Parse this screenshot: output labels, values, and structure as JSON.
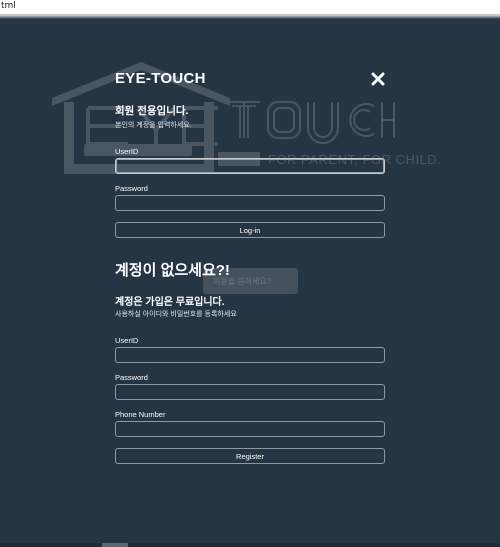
{
  "browser": {
    "url_fragment": "tml"
  },
  "background": {
    "logo_text": "TOUCH",
    "tagline": "FOR PARENT, FOR CHILD.",
    "hint": "이용을 원하세요?"
  },
  "login": {
    "brand": "EYE-TOUCH",
    "title": "회원 전용입니다.",
    "subtitle": "본인의 계정을 입력하세요.",
    "userid_label": "UserID",
    "userid_value": "",
    "password_label": "Password",
    "password_value": "",
    "button_label": "Log-in"
  },
  "register": {
    "heading": "계정이 없으세요?!",
    "title": "계정은 가입은 무료입니다.",
    "subtitle": "사용하실 아이디와 비밀번호를 등록하세요",
    "userid_label": "UserID",
    "userid_value": "",
    "password_label": "Password",
    "password_value": "",
    "phone_label": "Phone Number",
    "phone_value": "",
    "button_label": "Register"
  },
  "icons": {
    "close": "close-icon"
  },
  "colors": {
    "background": "#263543",
    "text": "#ffffff",
    "field_border": "#8d98a2"
  }
}
